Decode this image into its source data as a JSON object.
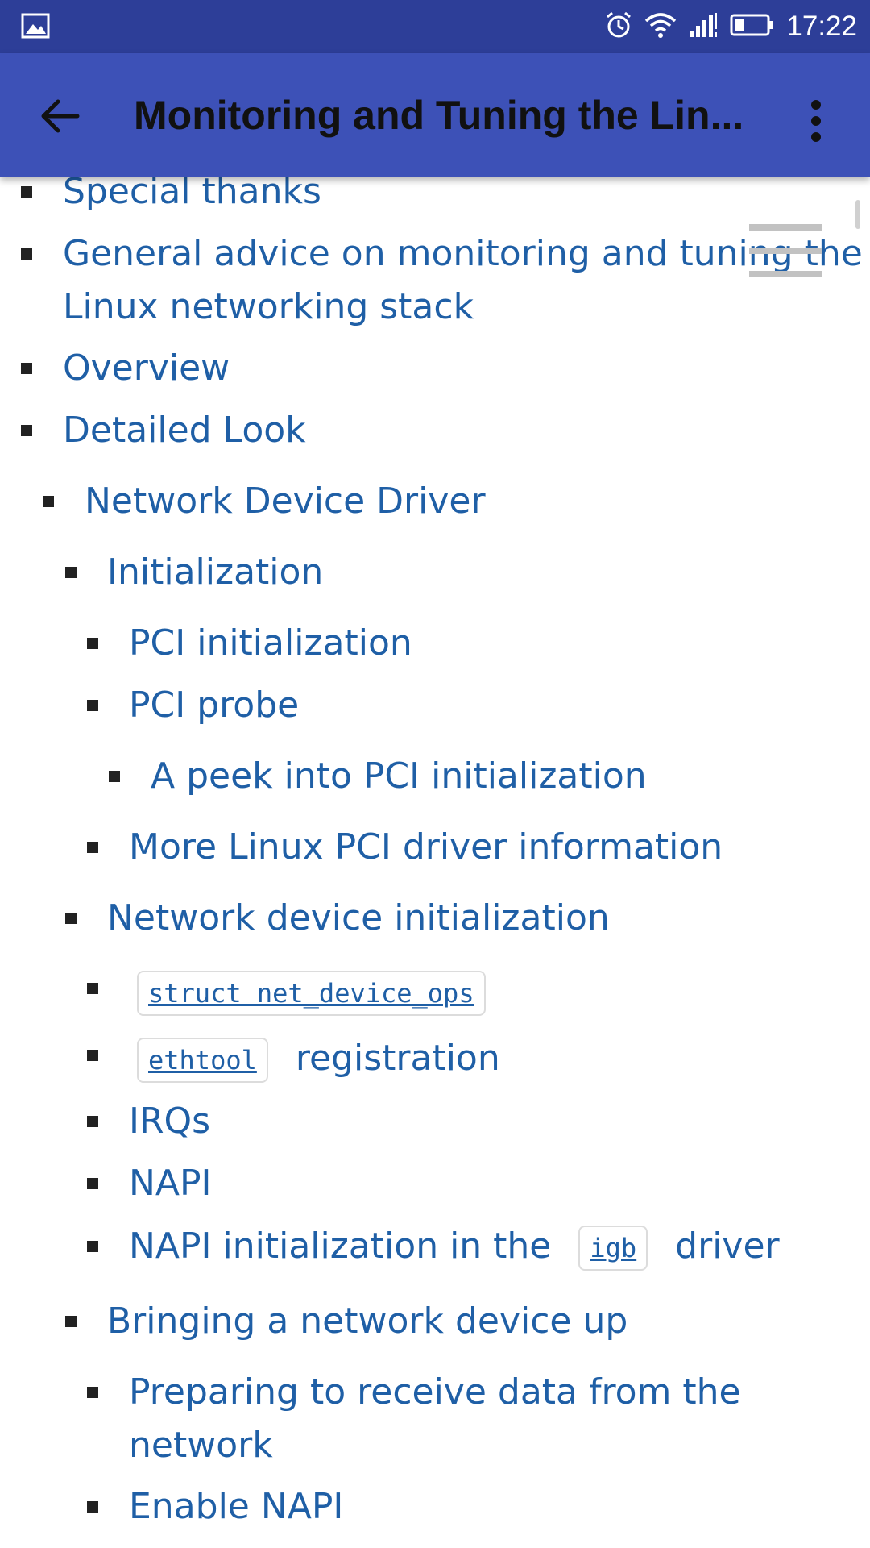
{
  "status_bar": {
    "time": "17:22"
  },
  "app_bar": {
    "title": "Monitoring and Tuning the Lin..."
  },
  "toc": {
    "items": [
      {
        "label": "Special thanks"
      },
      {
        "label": "General advice on monitoring and tuning the",
        "label2": "Linux networking stack"
      },
      {
        "label": "Overview"
      },
      {
        "label": "Detailed Look"
      },
      {
        "label": "Network Device Driver"
      },
      {
        "label": "Initialization"
      },
      {
        "label": "PCI initialization"
      },
      {
        "label": "PCI probe"
      },
      {
        "label": "A peek into PCI initialization"
      },
      {
        "label": "More Linux PCI driver information"
      },
      {
        "label": "Network device initialization"
      },
      {
        "code": "struct net_device_ops"
      },
      {
        "code": "ethtool",
        "label": "registration"
      },
      {
        "label": "IRQs"
      },
      {
        "label": "NAPI"
      },
      {
        "label": "NAPI initialization in the",
        "code": "igb",
        "label_after": "driver"
      },
      {
        "label": "Bringing a network device up"
      },
      {
        "label": "Preparing to receive data from the",
        "label2": "network"
      },
      {
        "label": "Enable NAPI"
      }
    ]
  },
  "colors": {
    "link": "#1f5fa6",
    "app_bar": "#3d51b7",
    "status_bar": "#2d3e98"
  },
  "icons": [
    "image-icon",
    "alarm-icon",
    "wifi-icon",
    "signal-icon",
    "battery-icon",
    "back-arrow-icon",
    "more-vert-icon",
    "hamburger-icon"
  ]
}
